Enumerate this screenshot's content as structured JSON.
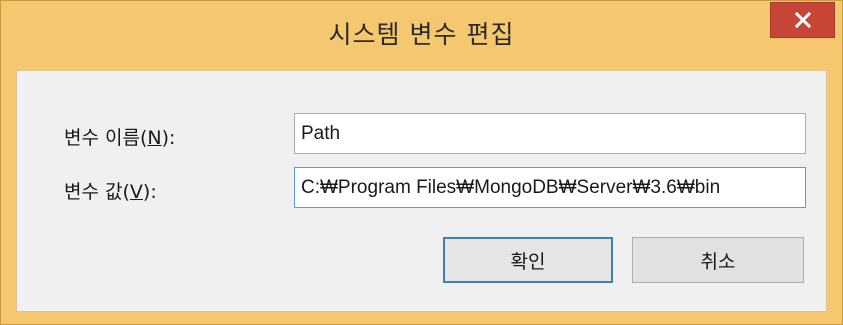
{
  "window": {
    "title": "시스템 변수 편집",
    "colors": {
      "frame": "#f5c86f",
      "close": "#c74537",
      "client": "#f0f0f0"
    }
  },
  "form": {
    "name_label_prefix": "변수 이름(",
    "name_label_mnemonic": "N",
    "name_label_suffix": "):",
    "name_value": "Path",
    "value_label_prefix": "변수 값(",
    "value_label_mnemonic": "V",
    "value_label_suffix": "):",
    "value_value": "C:₩Program Files₩MongoDB₩Server₩3.6₩bin"
  },
  "buttons": {
    "ok": "확인",
    "cancel": "취소"
  },
  "icons": {
    "close": "close-icon"
  }
}
